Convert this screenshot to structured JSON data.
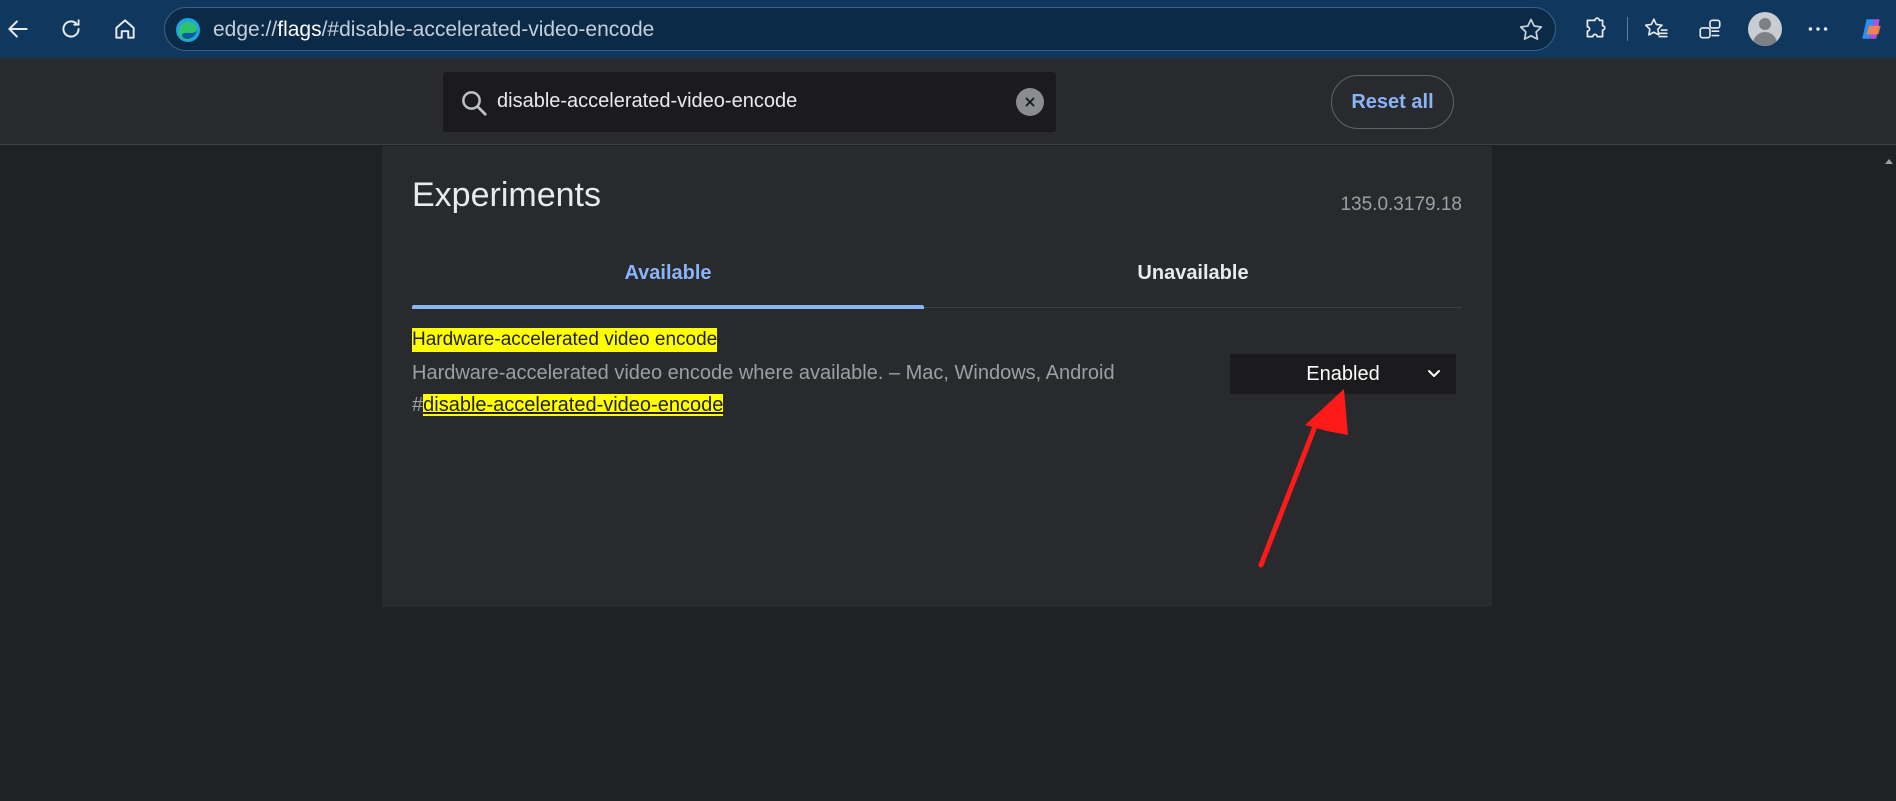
{
  "browser": {
    "url_scheme": "edge://",
    "url_host": "flags",
    "url_path": "/#disable-accelerated-video-encode"
  },
  "flags_header": {
    "search_value": "disable-accelerated-video-encode",
    "reset_label": "Reset all"
  },
  "page": {
    "title": "Experiments",
    "version": "135.0.3179.18",
    "tabs": [
      {
        "label": "Available",
        "active": true
      },
      {
        "label": "Unavailable",
        "active": false
      }
    ]
  },
  "experiment": {
    "name": "Hardware-accelerated video encode",
    "description": "Hardware-accelerated video encode where available. – Mac, Windows, Android",
    "hash_prefix": "#",
    "flag_id": "disable-accelerated-video-encode",
    "selected_option": "Enabled"
  },
  "colors": {
    "toolbar": "#10385e",
    "background": "#202124",
    "panel": "#292a2d",
    "accent": "#8ab4f8",
    "highlight": "#ffff00",
    "annotation_arrow": "#ff1a1a"
  }
}
